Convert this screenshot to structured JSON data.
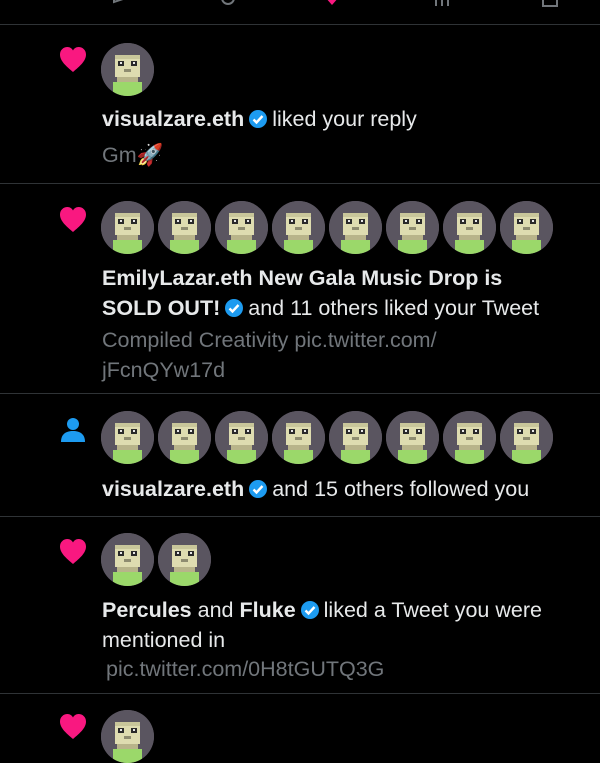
{
  "notifications": [
    {
      "icon": "heart-icon",
      "avatar_count": 1,
      "user": "visualzare.eth",
      "action": "liked your reply",
      "preview": "Gm🚀"
    },
    {
      "icon": "heart-icon",
      "avatar_count": 8,
      "user_line1": "EmilyLazar.eth New Gala Music Drop is",
      "user_line2": "SOLD OUT!",
      "action": "and 11 others liked your Tweet",
      "preview_line1": "Compiled Creativity pic.twitter.com/",
      "preview_line2": "jFcnQYw17d"
    },
    {
      "icon": "person-icon",
      "avatar_count": 8,
      "user": "visualzare.eth",
      "action": "and 15 others followed you"
    },
    {
      "icon": "heart-icon",
      "avatar_count": 2,
      "user1": "Percules",
      "connector": "and",
      "user2": "Fluke",
      "action_line1": "liked a Tweet you were",
      "action_line2": "mentioned in",
      "preview": "pic.twitter.com/0H8tGUTQ3G"
    },
    {
      "icon": "heart-icon",
      "avatar_count": 1
    }
  ],
  "colors": {
    "background": "#000000",
    "heart": "#f91880",
    "verified": "#1d9bf0",
    "person": "#1d9bf0",
    "muted_text": "#71767b",
    "divider": "#2f3336"
  }
}
